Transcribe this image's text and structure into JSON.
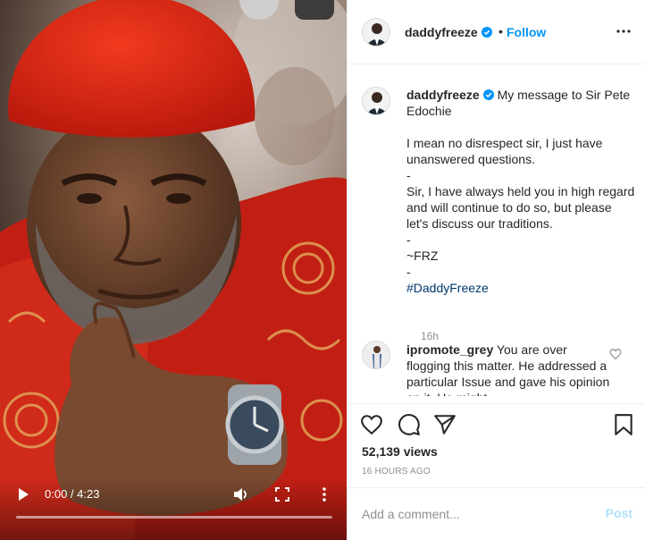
{
  "video": {
    "current_time": "0:00",
    "duration": "4:23",
    "progress_fraction": 0.0,
    "icons": [
      "play-icon",
      "volume-icon",
      "fullscreen-icon",
      "more-vertical-icon"
    ]
  },
  "post": {
    "username": "daddyfreeze",
    "follow_label": "Follow",
    "separator": "•",
    "caption": {
      "message_line": "My message to Sir Pete Edochie",
      "body": "\n\nI mean no disrespect sir, I just have unanswered questions.\n-\nSir, I have always held you in high regard and will continue to do so, but please let's discuss our traditions.\n-\n~FRZ\n-\n",
      "hashtag": "#DaddyFreeze",
      "time": "16h"
    },
    "comments": [
      {
        "username": "ipromote_grey",
        "text": "You are over flogging this matter. He addressed a particular Issue and gave his opinion on it. He might"
      }
    ],
    "views": "52,139 views",
    "posted_ago": "16 HOURS AGO"
  },
  "composer": {
    "placeholder": "Add a comment...",
    "post_label": "Post"
  },
  "colors": {
    "accent": "#0095f6",
    "verified": "#0095f6",
    "post_disabled": "#b2dffc",
    "hashtag": "#00376b",
    "muted": "#8e8e8e"
  }
}
